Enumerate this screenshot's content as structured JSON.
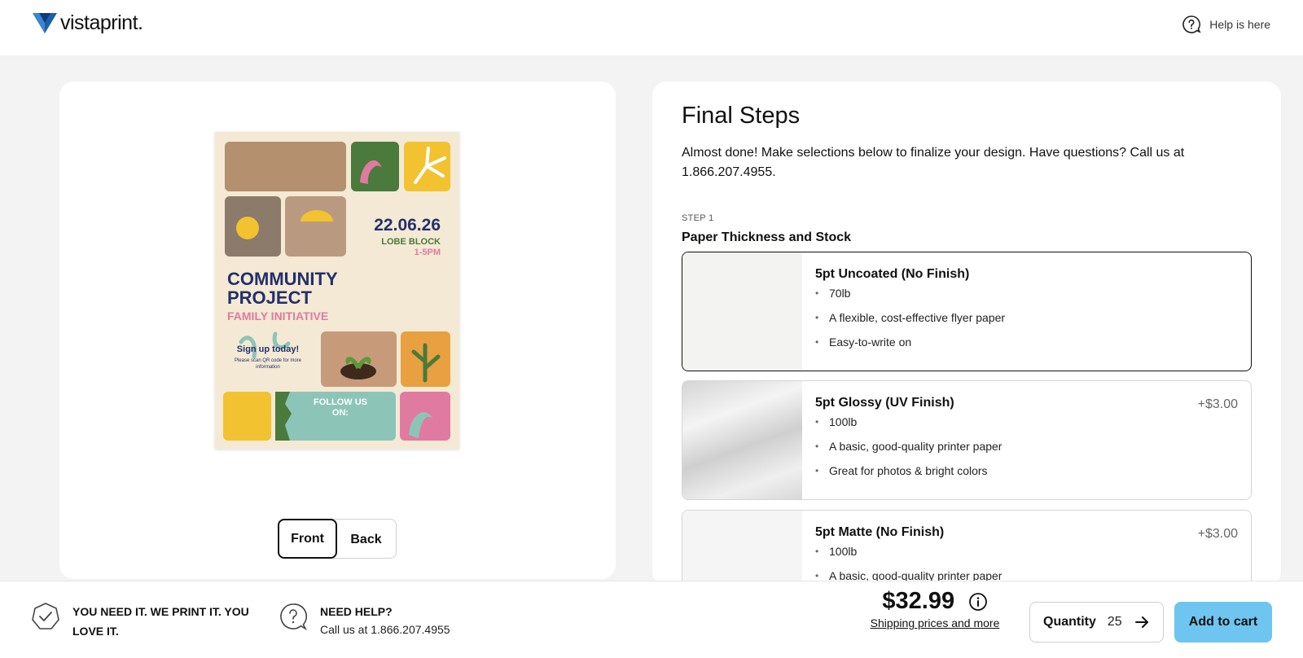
{
  "header": {
    "brand": "vistaprint.",
    "help_label": "Help is here"
  },
  "preview": {
    "flyer": {
      "date": "22.06.26",
      "venue": "LOBE BLOCK",
      "time": "1-5PM",
      "headline_line1": "COMMUNITY",
      "headline_line2": "PROJECT",
      "subhead": "FAMILY INITIATIVE",
      "signup": "Sign up today!",
      "signup_sub_1": "Please scan QR code for more",
      "signup_sub_2": "information",
      "follow_1": "FOLLOW US",
      "follow_2": "ON:"
    },
    "toggle": {
      "front": "Front",
      "back": "Back",
      "active": "front"
    }
  },
  "final_steps": {
    "title": "Final Steps",
    "intro": "Almost done! Make selections below to finalize your design. Have questions? Call us at 1.866.207.4955.",
    "step_label": "STEP 1",
    "step_title": "Paper Thickness and Stock",
    "options": [
      {
        "name": "5pt Uncoated (No Finish)",
        "price": "",
        "bullets": [
          "70lb",
          "A flexible, cost-effective flyer paper",
          "Easy-to-write on"
        ],
        "selected": true
      },
      {
        "name": "5pt Glossy (UV Finish)",
        "price": "+$3.00",
        "bullets": [
          "100lb",
          "A basic, good-quality printer paper",
          "Great for photos & bright colors"
        ],
        "selected": false
      },
      {
        "name": "5pt Matte (No Finish)",
        "price": "+$3.00",
        "bullets": [
          "100lb",
          "A basic, good-quality printer paper"
        ],
        "selected": false
      }
    ]
  },
  "footer": {
    "promo": "YOU NEED IT. WE PRINT IT. YOU LOVE IT.",
    "help_title": "NEED HELP?",
    "help_sub": "Call us at 1.866.207.4955",
    "price": "$32.99",
    "shipping_link": "Shipping prices and more",
    "quantity_label": "Quantity",
    "quantity_value": "25",
    "add_to_cart": "Add to cart"
  },
  "colors": {
    "accent": "#6ec5f0",
    "brand_blue": "#1c5fa8",
    "flyer_navy": "#23306b",
    "flyer_pink": "#e07aa0",
    "flyer_green": "#4a7a3c",
    "flyer_yellow": "#f2c230",
    "flyer_teal": "#8cc5b8",
    "flyer_orange": "#e9a040"
  },
  "icons": {
    "help": "question-circle-icon",
    "promo": "badge-check-icon",
    "need_help": "chat-question-icon",
    "info": "info-circle-icon",
    "arrow": "arrow-right-icon"
  }
}
